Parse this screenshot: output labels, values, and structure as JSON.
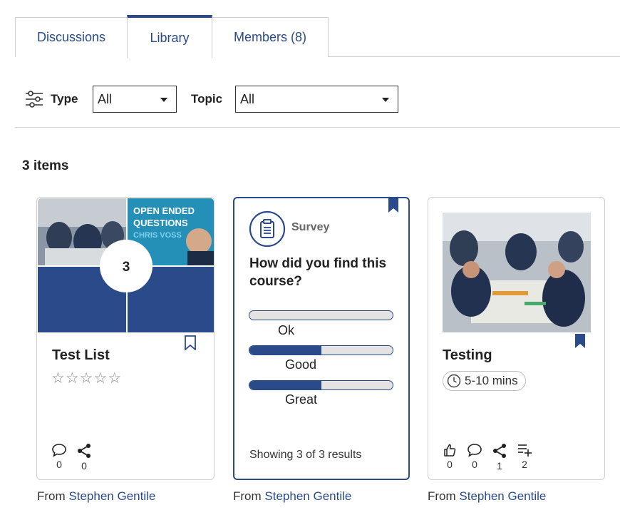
{
  "tabs": [
    {
      "label": "Discussions",
      "active": false
    },
    {
      "label": "Library",
      "active": true
    },
    {
      "label": "Members (8)",
      "active": false
    }
  ],
  "filters": {
    "icon": "filter-sliders-icon",
    "type_label": "Type",
    "type_value": "All",
    "topic_label": "Topic",
    "topic_value": "All"
  },
  "items_count": "3 items",
  "colors": {
    "accent": "#2a4a8a",
    "border": "#cfcfcf"
  },
  "cards": {
    "list": {
      "image_badge": "3",
      "image_poster_text": "OPEN ENDED QUESTIONS",
      "image_poster_subtext": "CHRIS VOSS",
      "title": "Test List",
      "rating": {
        "stars": 5,
        "value": 0
      },
      "comments": "0",
      "shares": "0",
      "from_prefix": "From",
      "author": "Stephen Gentile"
    },
    "survey": {
      "type_label": "Survey",
      "question": "How did you find this course?",
      "options": [
        {
          "label": "Ok",
          "fraction": 0.0
        },
        {
          "label": "Good",
          "fraction": 0.5
        },
        {
          "label": "Great",
          "fraction": 0.5
        }
      ],
      "results_text": "Showing 3 of 3 results",
      "from_prefix": "From",
      "author": "Stephen Gentile"
    },
    "testing": {
      "title": "Testing",
      "duration": "5-10 mins",
      "likes": "0",
      "comments": "0",
      "shares": "1",
      "playlist_adds": "2",
      "from_prefix": "From",
      "author": "Stephen Gentile"
    }
  }
}
